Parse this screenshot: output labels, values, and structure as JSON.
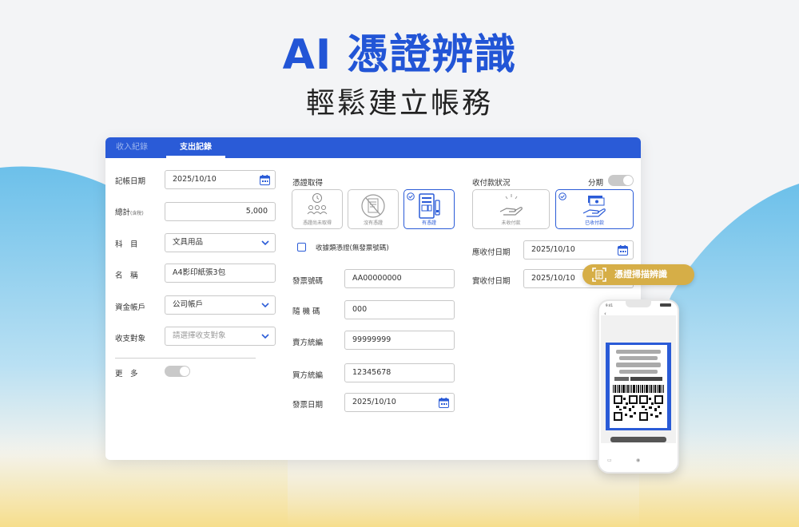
{
  "hero": {
    "title": "AI 憑證辨識",
    "subtitle": "輕鬆建立帳務"
  },
  "tabs": [
    {
      "label": "收入紀錄",
      "active": false
    },
    {
      "label": "支出記錄",
      "active": true
    }
  ],
  "left": {
    "date_label": "記帳日期",
    "date_value": "2025/10/10",
    "total_label": "總計",
    "total_suffix": "(含稅)",
    "total_value": "5,000",
    "category_label": "科　目",
    "category_value": "文具用品",
    "name_label": "名　稱",
    "name_value": "A4影印紙張3包",
    "account_label": "資金帳戶",
    "account_value": "公司帳戶",
    "counterparty_label": "收支對象",
    "counterparty_placeholder": "請選擇收支對象",
    "more_label": "更　多"
  },
  "middle": {
    "voucher_label": "憑證取得",
    "voucher_options": [
      {
        "label": "憑證尚未取得",
        "icon": "people-clock-icon",
        "selected": false
      },
      {
        "label": "沒有憑證",
        "icon": "no-receipt-icon",
        "selected": false
      },
      {
        "label": "有憑證",
        "icon": "receipt-icon",
        "selected": true
      }
    ],
    "receipt_type_label": "收據類憑證(無發票號碼)",
    "invoice_no_label": "發票號碼",
    "invoice_no_value": "AA00000000",
    "random_code_label": "隨 機 碼",
    "random_code_value": "000",
    "seller_id_label": "賣方統編",
    "seller_id_value": "99999999",
    "buyer_id_label": "買方統編",
    "buyer_id_value": "12345678",
    "invoice_date_label": "發票日期",
    "invoice_date_value": "2025/10/10"
  },
  "right": {
    "status_label": "收付款狀況",
    "installment_label": "分期",
    "status_options": [
      {
        "label": "未收付款",
        "icon": "hand-coin-icon",
        "selected": false
      },
      {
        "label": "已收付款",
        "icon": "hand-cash-icon",
        "selected": true
      }
    ],
    "due_date_label": "應收付日期",
    "due_date_value": "2025/10/10",
    "actual_date_label": "實收付日期",
    "actual_date_value": "2025/10/10"
  },
  "scan_badge": {
    "label": "憑證掃描辨識",
    "icon": "scan-icon"
  },
  "phone": {
    "time": "9:41",
    "back": "‹"
  },
  "colors": {
    "accent": "#2a5bd7",
    "title_blue": "#2255d6",
    "badge_gold": "#d6ae47",
    "wave_blue": "#7cc6e8"
  }
}
